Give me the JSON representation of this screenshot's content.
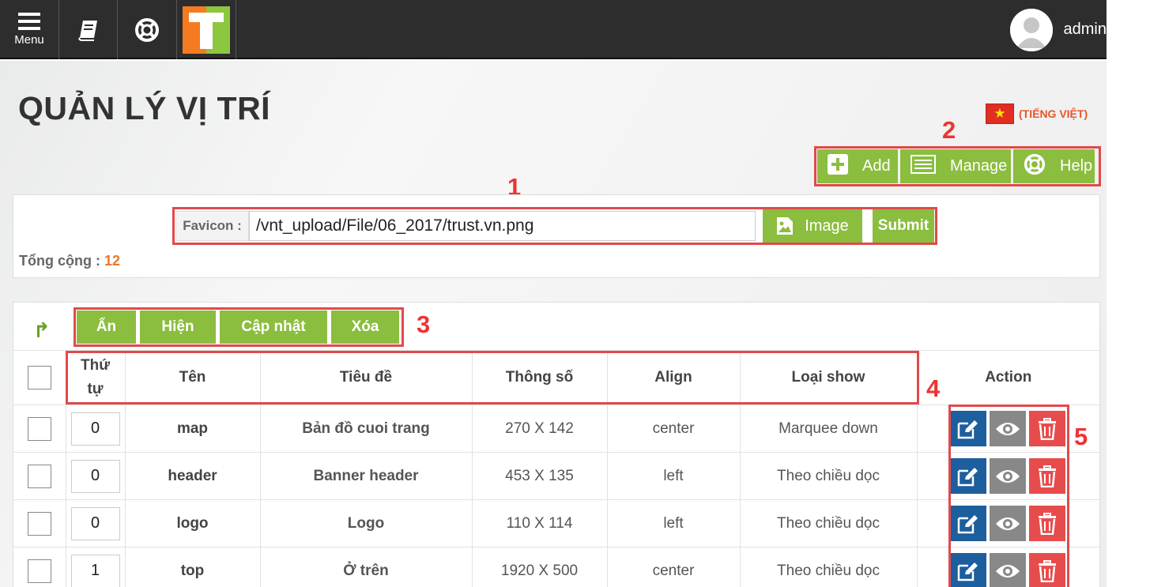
{
  "topbar": {
    "menu_label": "Menu",
    "icons": [
      "menu-icon",
      "book-icon",
      "lifebuoy-icon",
      "logo"
    ],
    "user_name": "admin"
  },
  "page": {
    "title": "QUẢN LÝ VỊ TRÍ",
    "language": "(TIẾNG VIỆT)"
  },
  "header_buttons": {
    "add": "Add",
    "manage": "Manage",
    "help": "Help"
  },
  "favicon": {
    "label": "Favicon :",
    "value": "/vnt_upload/File/06_2017/trust.vn.png",
    "image_button": "Image",
    "submit_button": "Submit"
  },
  "total": {
    "label": "Tổng cộng :",
    "count": "12"
  },
  "bulk_actions": {
    "hide": "Ẩn",
    "show": "Hiện",
    "update": "Cập nhật",
    "delete": "Xóa"
  },
  "table": {
    "headers": {
      "order_line1": "Thứ",
      "order_line2": "tự",
      "name": "Tên",
      "title": "Tiêu đề",
      "params": "Thông số",
      "align": "Align",
      "show_type": "Loại show",
      "action": "Action"
    },
    "rows": [
      {
        "order": "0",
        "name": "map",
        "title": "Bản đồ cuoi trang",
        "params": "270 X 142",
        "align": "center",
        "show_type": "Marquee down"
      },
      {
        "order": "0",
        "name": "header",
        "title": "Banner header",
        "params": "453 X 135",
        "align": "left",
        "show_type": "Theo chiều dọc"
      },
      {
        "order": "0",
        "name": "logo",
        "title": "Logo",
        "params": "110 X 114",
        "align": "left",
        "show_type": "Theo chiều dọc"
      },
      {
        "order": "1",
        "name": "top",
        "title": "Ở trên",
        "params": "1920 X 500",
        "align": "center",
        "show_type": "Theo chiều dọc"
      }
    ]
  },
  "annotations": [
    "1",
    "2",
    "3",
    "4",
    "5"
  ],
  "colors": {
    "accent_green": "#8bbd3f",
    "edit_blue": "#1c5e9e",
    "view_gray": "#888888",
    "delete_red": "#e74c4c",
    "annotation_red": "#e33333",
    "topbar": "#2d2d2d"
  }
}
